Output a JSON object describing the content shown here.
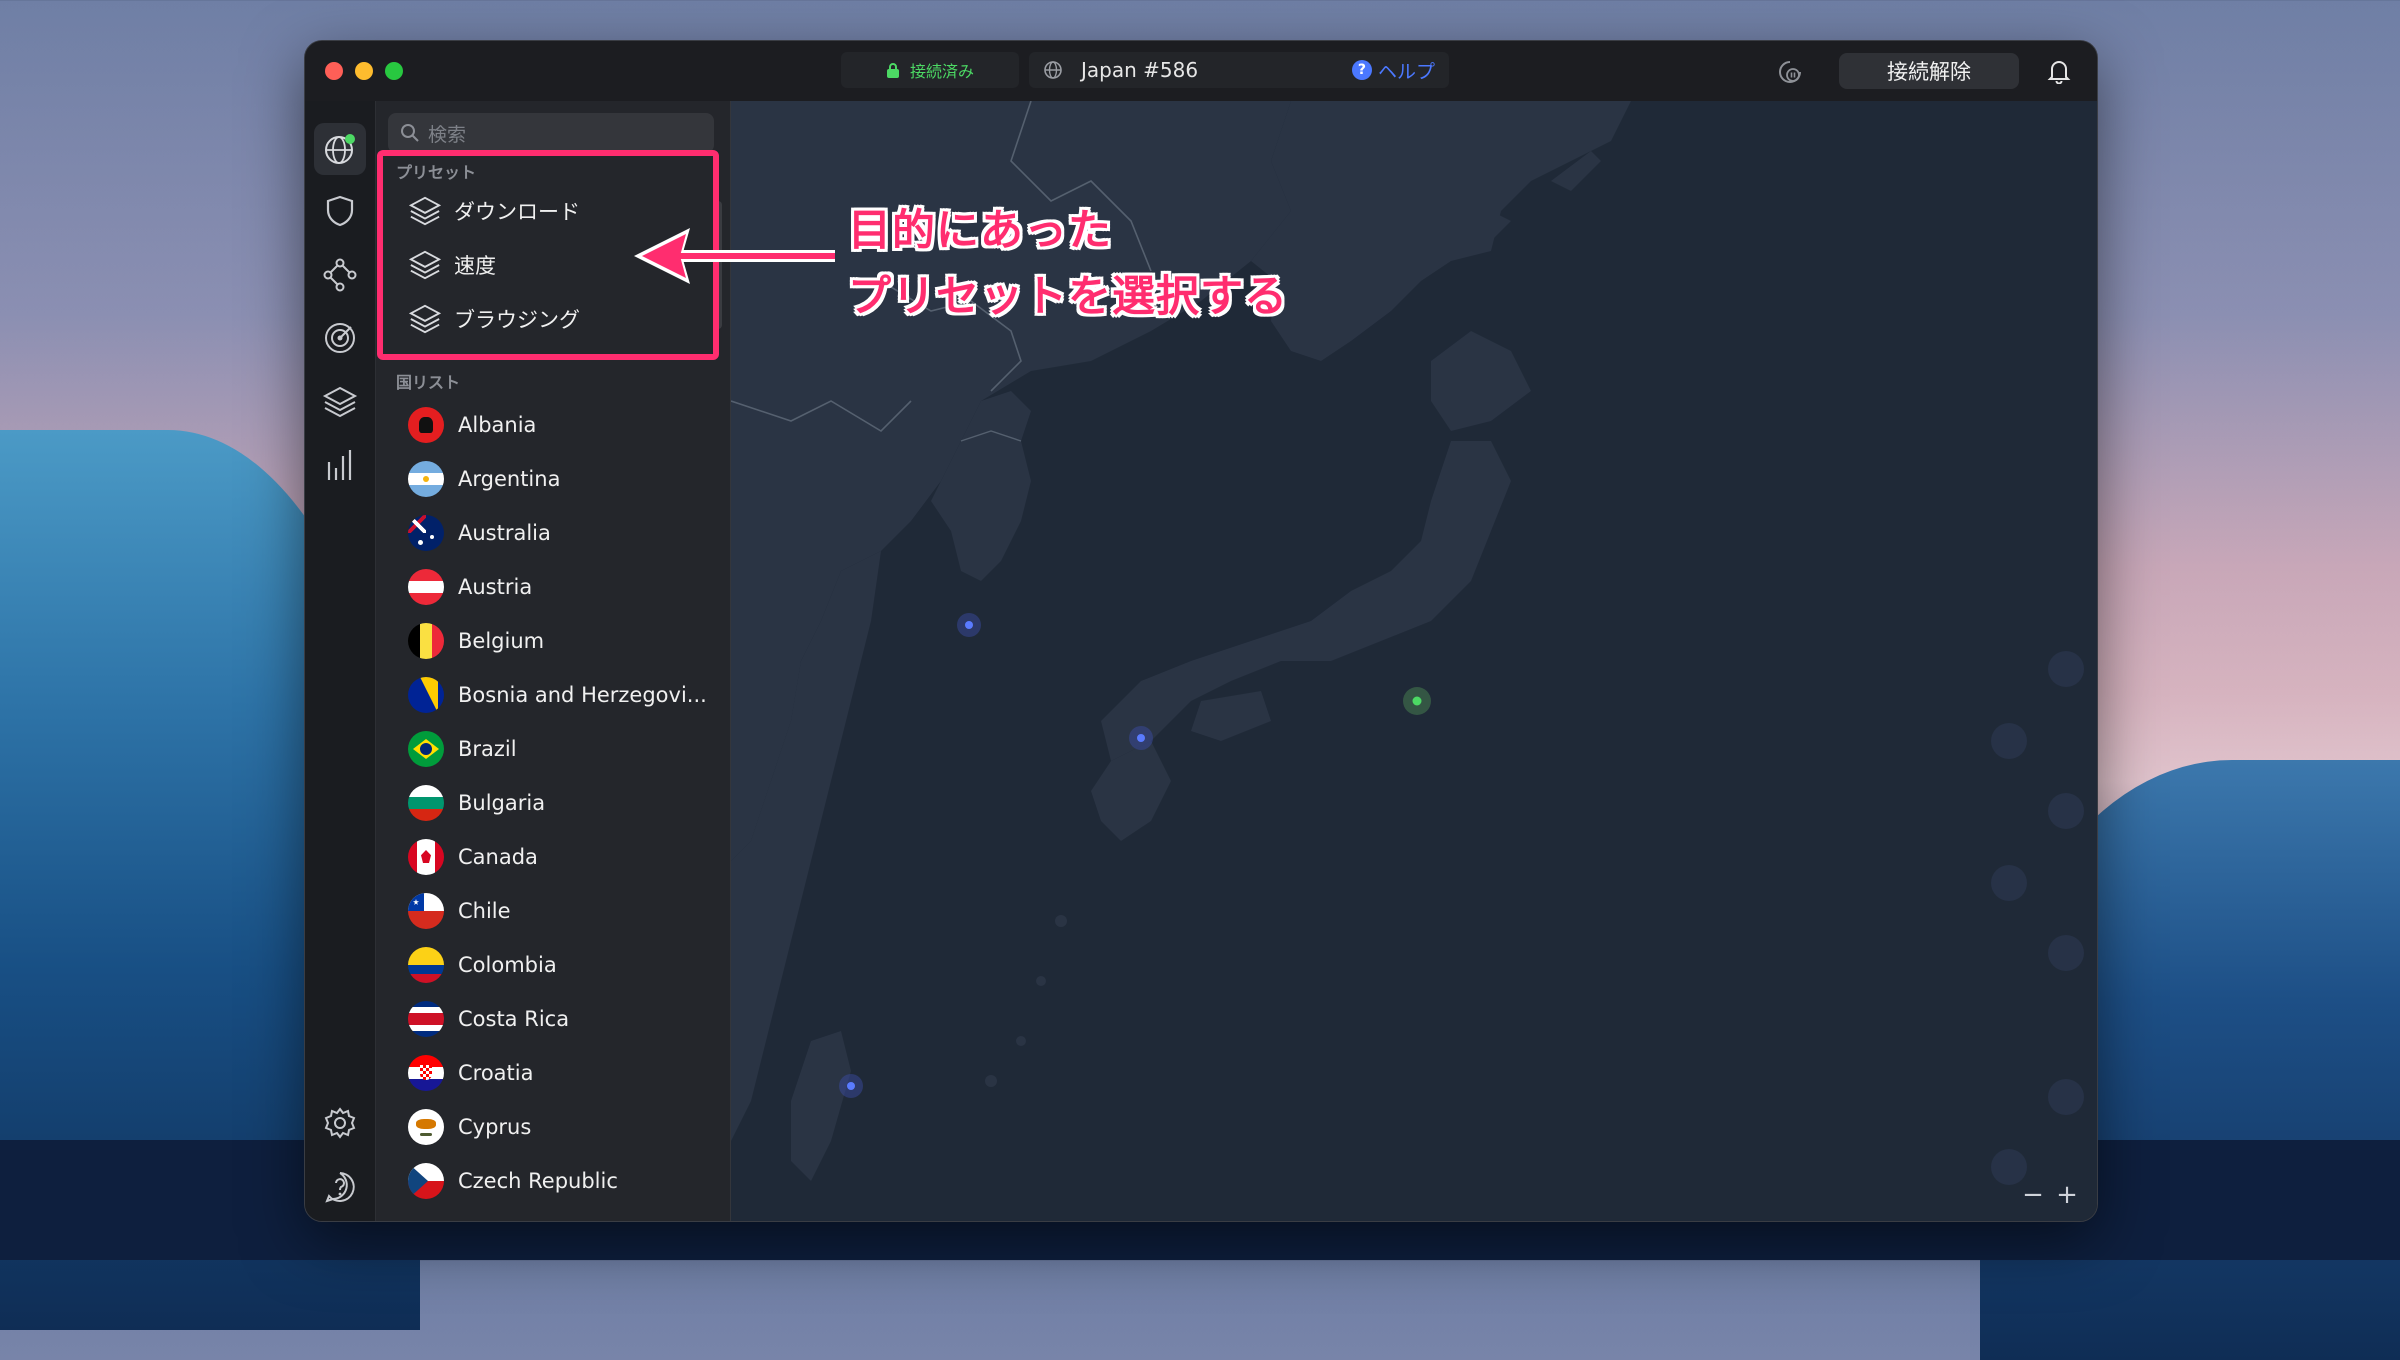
{
  "titlebar": {
    "status": "接続済み",
    "server": "Japan #586",
    "help": "ヘルプ",
    "disconnect": "接続解除"
  },
  "rail": {
    "items": [
      "globe-icon",
      "shield-icon",
      "meshnet-icon",
      "target-icon",
      "layers-icon",
      "stats-icon"
    ],
    "bottom": [
      "gear-icon",
      "help-icon"
    ]
  },
  "sidebar": {
    "search_placeholder": "検索",
    "presets_label": "プリセット",
    "presets": [
      "ダウンロード",
      "速度",
      "ブラウジング"
    ],
    "countries_label": "国リスト",
    "countries": [
      "Albania",
      "Argentina",
      "Australia",
      "Austria",
      "Belgium",
      "Bosnia and Herzegovi...",
      "Brazil",
      "Bulgaria",
      "Canada",
      "Chile",
      "Colombia",
      "Costa Rica",
      "Croatia",
      "Cyprus",
      "Czech Republic"
    ]
  },
  "annotation": {
    "line1": "目的にあった",
    "line2": "プリセットを選択する",
    "color": "#ff2d6f"
  },
  "map": {
    "zoom_out": "−",
    "zoom_in": "+"
  },
  "colors": {
    "connected": "#4cd964",
    "accent": "#4b78ff"
  }
}
